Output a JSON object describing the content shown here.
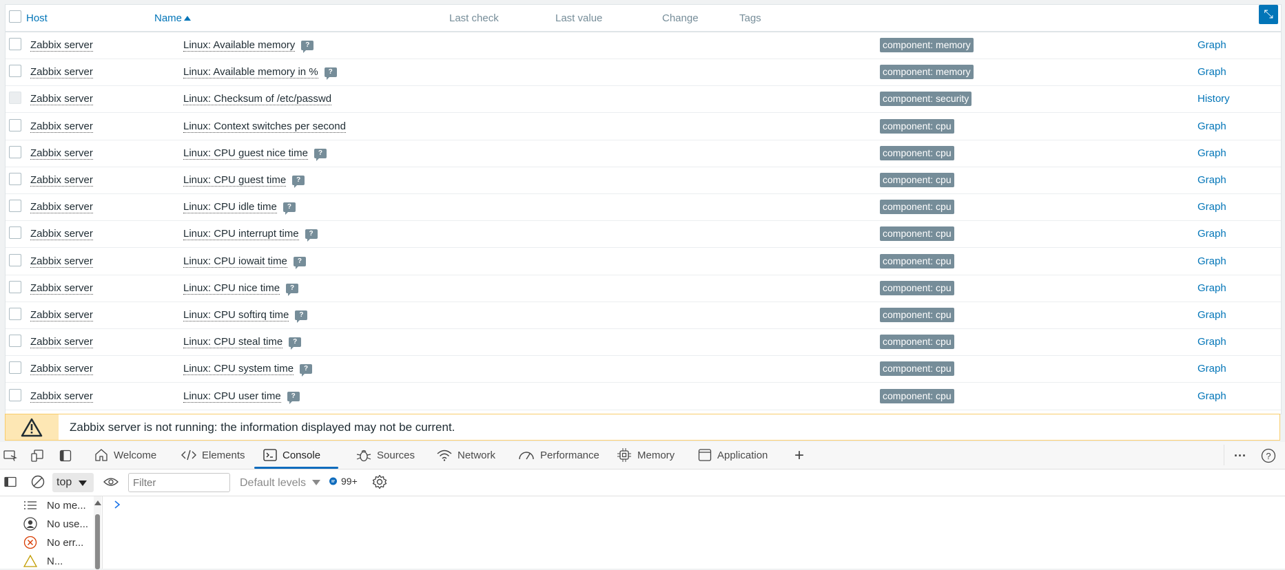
{
  "table": {
    "headers": {
      "host": "Host",
      "name": "Name",
      "last_check": "Last check",
      "last_value": "Last value",
      "change": "Change",
      "tags": "Tags"
    },
    "rows": [
      {
        "host": "Zabbix server",
        "name": "Linux: Available memory",
        "hint": "?",
        "tag": "component: memory",
        "action": "Graph"
      },
      {
        "host": "Zabbix server",
        "name": "Linux: Available memory in %",
        "hint": "?",
        "tag": "component: memory",
        "action": "Graph"
      },
      {
        "host": "Zabbix server",
        "name": "Linux: Checksum of /etc/passwd",
        "hint": "",
        "tag": "component: security",
        "action": "History",
        "disabled": true
      },
      {
        "host": "Zabbix server",
        "name": "Linux: Context switches per second",
        "hint": "",
        "tag": "component: cpu",
        "action": "Graph"
      },
      {
        "host": "Zabbix server",
        "name": "Linux: CPU guest nice time",
        "hint": "?",
        "tag": "component: cpu",
        "action": "Graph"
      },
      {
        "host": "Zabbix server",
        "name": "Linux: CPU guest time",
        "hint": "?",
        "tag": "component: cpu",
        "action": "Graph"
      },
      {
        "host": "Zabbix server",
        "name": "Linux: CPU idle time",
        "hint": "?",
        "tag": "component: cpu",
        "action": "Graph"
      },
      {
        "host": "Zabbix server",
        "name": "Linux: CPU interrupt time",
        "hint": "?",
        "tag": "component: cpu",
        "action": "Graph"
      },
      {
        "host": "Zabbix server",
        "name": "Linux: CPU iowait time",
        "hint": "?",
        "tag": "component: cpu",
        "action": "Graph"
      },
      {
        "host": "Zabbix server",
        "name": "Linux: CPU nice time",
        "hint": "?",
        "tag": "component: cpu",
        "action": "Graph"
      },
      {
        "host": "Zabbix server",
        "name": "Linux: CPU softirq time",
        "hint": "?",
        "tag": "component: cpu",
        "action": "Graph"
      },
      {
        "host": "Zabbix server",
        "name": "Linux: CPU steal time",
        "hint": "?",
        "tag": "component: cpu",
        "action": "Graph"
      },
      {
        "host": "Zabbix server",
        "name": "Linux: CPU system time",
        "hint": "?",
        "tag": "component: cpu",
        "action": "Graph"
      },
      {
        "host": "Zabbix server",
        "name": "Linux: CPU user time",
        "hint": "?",
        "tag": "component: cpu",
        "action": "Graph"
      }
    ]
  },
  "warning": {
    "text": "Zabbix server is not running: the information displayed may not be current."
  },
  "devtools": {
    "tabs": [
      {
        "label": "Welcome",
        "icon": "home-icon"
      },
      {
        "label": "Elements",
        "icon": "code-icon"
      },
      {
        "label": "Console",
        "icon": "console-icon",
        "active": true
      },
      {
        "label": "Sources",
        "icon": "bug-icon"
      },
      {
        "label": "Network",
        "icon": "wifi-icon"
      },
      {
        "label": "Performance",
        "icon": "gauge-icon"
      },
      {
        "label": "Memory",
        "icon": "chip-icon"
      },
      {
        "label": "Application",
        "icon": "window-icon"
      }
    ],
    "context": "top",
    "filter_placeholder": "Filter",
    "levels": "Default levels",
    "message_count": "99+",
    "sidebar": [
      "No me...",
      "No use...",
      "No err...",
      "N..."
    ]
  }
}
